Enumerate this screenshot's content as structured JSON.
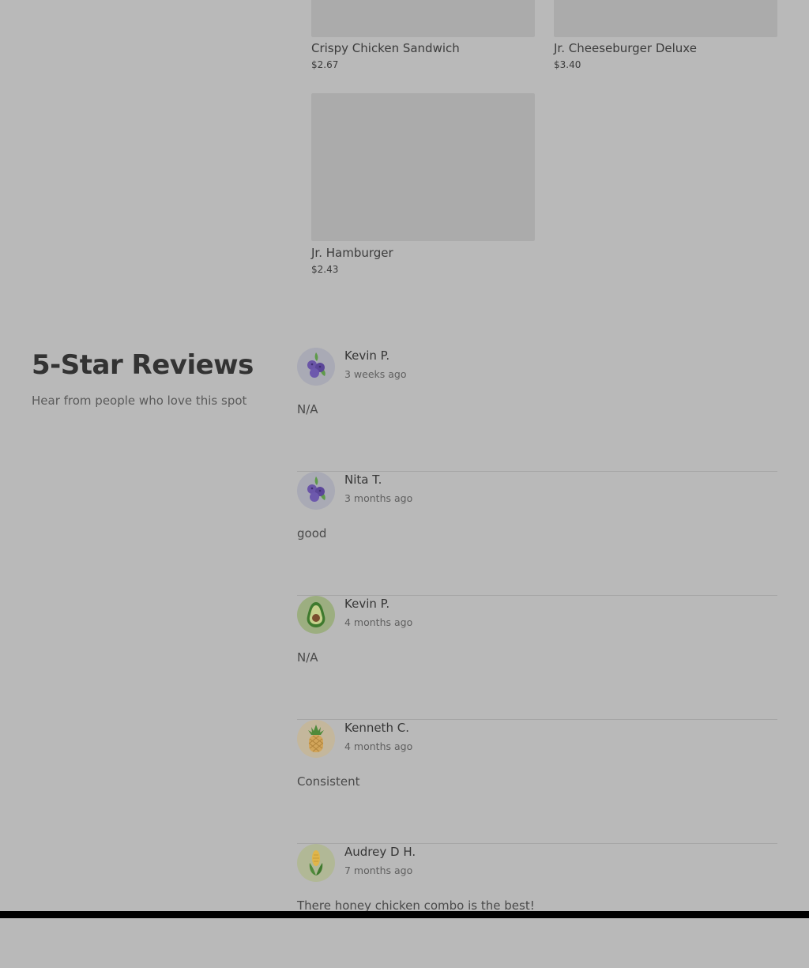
{
  "menu": {
    "items": [
      {
        "name": "Crispy Chicken Sandwich",
        "price": "$2.67"
      },
      {
        "name": "Jr. Cheeseburger Deluxe",
        "price": "$3.40"
      },
      {
        "name": "Jr. Hamburger",
        "price": "$2.43"
      }
    ]
  },
  "reviews": {
    "title": "5-Star Reviews",
    "subtitle": "Hear from people who love this spot",
    "items": [
      {
        "name": "Kevin P.",
        "time": "3 weeks ago",
        "text": "N/A",
        "avatar_icon": "blueberry-icon",
        "avatar_color": "#a9aab5"
      },
      {
        "name": "Nita T.",
        "time": "3 months ago",
        "text": "good",
        "avatar_icon": "blueberry-icon",
        "avatar_color": "#a9aab5"
      },
      {
        "name": "Kevin P.",
        "time": "4 months ago",
        "text": "N/A",
        "avatar_icon": "avocado-icon",
        "avatar_color": "#9cae80"
      },
      {
        "name": "Kenneth C.",
        "time": "4 months ago",
        "text": "Consistent",
        "avatar_icon": "pineapple-icon",
        "avatar_color": "#c4b79c"
      },
      {
        "name": "Audrey D H.",
        "time": "7 months ago",
        "text": "There honey chicken combo is the best!",
        "avatar_icon": "corn-icon",
        "avatar_color": "#b1b896"
      }
    ]
  },
  "colors": {
    "background": "#b9b9b9",
    "image_placeholder": "#ababab",
    "divider": "#a6a6a6"
  }
}
